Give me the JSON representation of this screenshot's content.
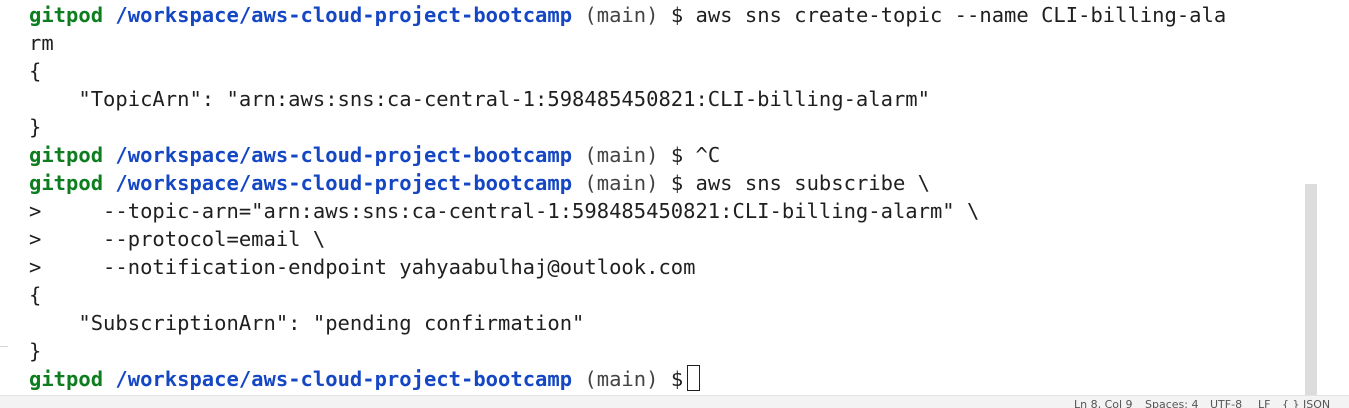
{
  "terminal": {
    "prompt": {
      "user": "gitpod",
      "path": "/workspace/aws-cloud-project-bootcamp",
      "branch": "(main)",
      "symbol": "$"
    },
    "commands": {
      "create_topic": " aws sns create-topic --name CLI-billing-ala",
      "create_topic_wrap": "rm",
      "cancel": " ^C",
      "subscribe": " aws sns subscribe \\"
    },
    "output": {
      "brace_open": "{",
      "brace_close": "}",
      "topic_arn_line": "    \"TopicArn\": \"arn:aws:sns:ca-central-1:598485450821:CLI-billing-alarm\"",
      "subscription_arn_line": "    \"SubscriptionArn\": \"pending confirmation\""
    },
    "continuations": [
      ">     --topic-arn=\"arn:aws:sns:ca-central-1:598485450821:CLI-billing-alarm\" \\",
      ">     --protocol=email \\",
      ">     --notification-endpoint yahyaabulhaj@outlook.com"
    ]
  },
  "statusbar": {
    "position": "Ln 8, Col 9",
    "spaces": "Spaces: 4",
    "encoding": "UTF-8",
    "eol": "LF",
    "language": "{ } JSON"
  }
}
